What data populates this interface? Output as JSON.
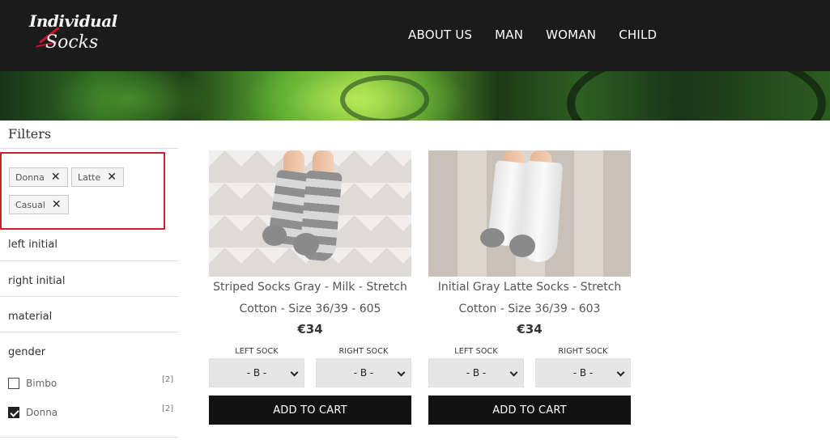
{
  "brand": {
    "logo_line1": "Individual",
    "logo_line2": "Socks",
    "accent_color": "#c4162a"
  },
  "nav": {
    "items": [
      {
        "label": "ABOUT US"
      },
      {
        "label": "MAN"
      },
      {
        "label": "WOMAN"
      },
      {
        "label": "CHILD"
      }
    ]
  },
  "filters": {
    "title": "Filters",
    "active": [
      {
        "label": "Donna",
        "remove_icon": "close-icon"
      },
      {
        "label": "Latte",
        "remove_icon": "close-icon"
      },
      {
        "label": "Casual",
        "remove_icon": "close-icon"
      }
    ],
    "facets": [
      {
        "label": "left initial"
      },
      {
        "label": "right initial"
      },
      {
        "label": "material"
      },
      {
        "label": "gender"
      }
    ],
    "gender_options": [
      {
        "label": "Bimbo",
        "count": "[2]",
        "checked": false
      },
      {
        "label": "Donna",
        "count": "[2]",
        "checked": true
      }
    ]
  },
  "products": [
    {
      "name_line1": "Striped Socks Gray - Milk - Stretch",
      "name_line2": "Cotton - Size 36/39 - 605",
      "price": "€34",
      "left_label": "LEFT SOCK",
      "right_label": "RIGHT SOCK",
      "left_value": "- B -",
      "right_value": "- B -",
      "cart_label": "ADD TO CART"
    },
    {
      "name_line1": "Initial Gray Latte Socks - Stretch",
      "name_line2": "Cotton - Size 36/39 - 603",
      "price": "€34",
      "left_label": "LEFT SOCK",
      "right_label": "RIGHT SOCK",
      "left_value": "- B -",
      "right_value": "- B -",
      "cart_label": "ADD TO CART"
    }
  ]
}
